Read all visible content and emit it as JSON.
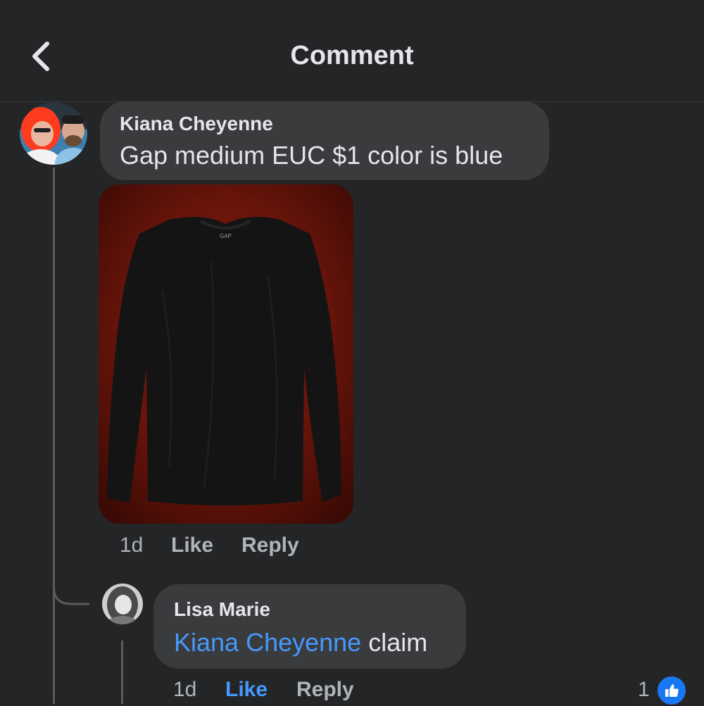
{
  "header": {
    "title": "Comment",
    "back_icon": "chevron-left-icon"
  },
  "comment": {
    "author": "Kiana Cheyenne",
    "text": "Gap medium EUC $1 color is blue",
    "photo_label": "GAP",
    "time": "1d",
    "like_label": "Like",
    "reply_label": "Reply"
  },
  "reply": {
    "author": "Lisa Marie",
    "mention": "Kiana Cheyenne",
    "text": " claim",
    "time": "1d",
    "like_label": "Like",
    "reply_label": "Reply",
    "reaction_count": "1",
    "reaction_icon": "thumbs-up-icon"
  },
  "colors": {
    "background": "#242526",
    "bubble": "#3a3b3c",
    "accent": "#4599ff",
    "muted": "#b0b3b8"
  }
}
